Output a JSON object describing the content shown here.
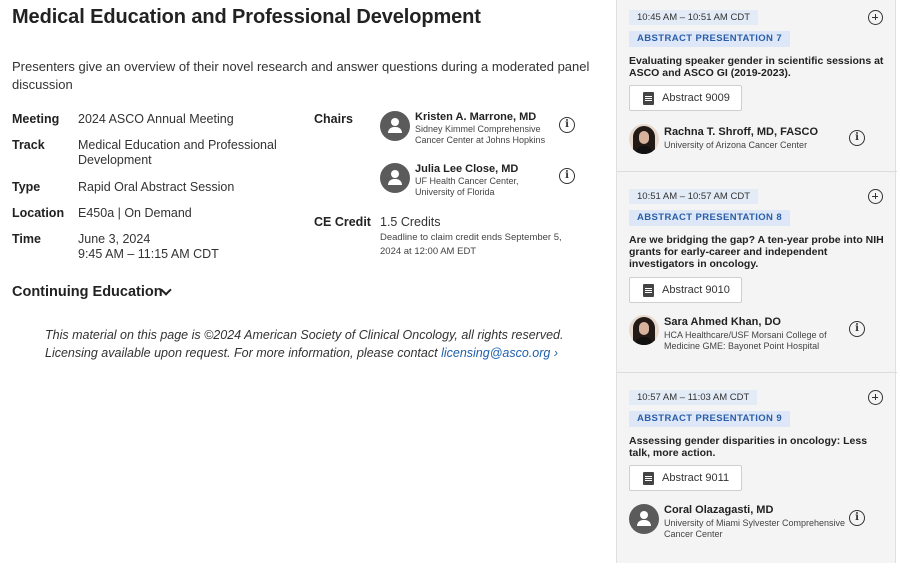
{
  "page": {
    "title": "Medical Education and Professional Development",
    "description": "Presenters give an overview of their novel research and answer questions during a moderated panel discussion"
  },
  "details": {
    "meeting_label": "Meeting",
    "meeting_value": "2024 ASCO Annual Meeting",
    "track_label": "Track",
    "track_value": "Medical Education and Professional Development",
    "type_label": "Type",
    "type_value": "Rapid Oral Abstract Session",
    "location_label": "Location",
    "location_value": "E450a | On Demand",
    "time_label": "Time",
    "time_date": "June 3, 2024",
    "time_range": "9:45 AM – 11:15 AM CDT"
  },
  "chairs": {
    "label": "Chairs",
    "items": [
      {
        "name": "Kristen A. Marrone, MD",
        "affiliation": "Sidney Kimmel Comprehensive Cancer Center at Johns Hopkins"
      },
      {
        "name": "Julia Lee Close, MD",
        "affiliation": "UF Health Cancer Center, University of Florida"
      }
    ]
  },
  "ce": {
    "label": "CE Credit",
    "credits": "1.5 Credits",
    "deadline": "Deadline to claim credit ends September 5, 2024 at 12:00 AM EDT"
  },
  "continuing_education": {
    "label": "Continuing Education"
  },
  "copyright": {
    "text": "This material on this page is ©2024 American Society of Clinical Oncology, all rights reserved. Licensing available upon request. For more information, please contact ",
    "link": "licensing@asco.org",
    "link_suffix": " ›"
  },
  "presentations": [
    {
      "time": "10:45 AM – 10:51 AM CDT",
      "label": "ABSTRACT PRESENTATION 7",
      "title": "Evaluating speaker gender in scientific sessions at ASCO and ASCO GI (2019-2023).",
      "abstract": "Abstract 9009",
      "presenter": "Rachna T. Shroff, MD, FASCO",
      "affiliation": "University of Arizona Cancer Center"
    },
    {
      "time": "10:51 AM – 10:57 AM CDT",
      "label": "ABSTRACT PRESENTATION 8",
      "title": "Are we bridging the gap? A ten-year probe into NIH grants for early-career and independent investigators in oncology.",
      "abstract": "Abstract 9010",
      "presenter": "Sara Ahmed Khan, DO",
      "affiliation": "HCA Healthcare/USF Morsani College of Medicine GME: Bayonet Point Hospital"
    },
    {
      "time": "10:57 AM – 11:03 AM CDT",
      "label": "ABSTRACT PRESENTATION 9",
      "title": "Assessing gender disparities in oncology: Less talk, more action.",
      "abstract": "Abstract 9011",
      "presenter": "Coral Olazagasti, MD",
      "affiliation": "University of Miami Sylvester Comprehensive Cancer Center"
    }
  ]
}
